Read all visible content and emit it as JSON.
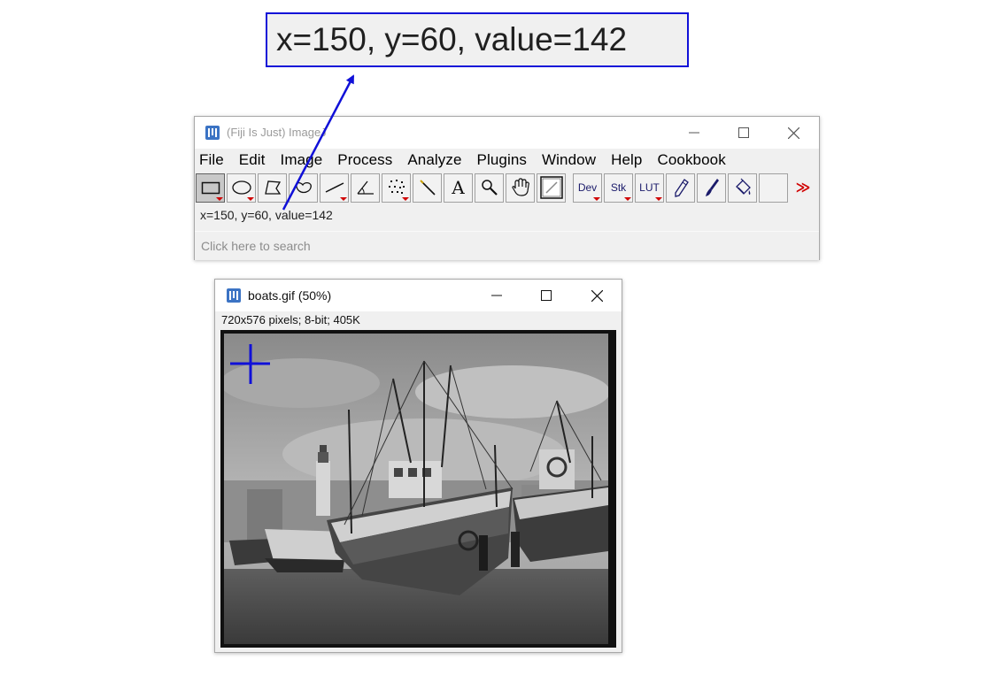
{
  "callout": {
    "text": "x=150, y=60, value=142"
  },
  "main_window": {
    "title": "(Fiji Is Just) ImageJ",
    "menus": [
      "File",
      "Edit",
      "Image",
      "Process",
      "Analyze",
      "Plugins",
      "Window",
      "Help",
      "Cookbook"
    ],
    "tools": [
      {
        "name": "rectangle-tool",
        "icon": "rectangle-icon",
        "active": true
      },
      {
        "name": "oval-tool",
        "icon": "oval-icon"
      },
      {
        "name": "polygon-tool",
        "icon": "polygon-icon"
      },
      {
        "name": "freehand-tool",
        "icon": "freehand-icon"
      },
      {
        "name": "line-tool",
        "icon": "line-icon"
      },
      {
        "name": "angle-tool",
        "icon": "angle-icon"
      },
      {
        "name": "point-tool",
        "icon": "point-icon"
      },
      {
        "name": "wand-tool",
        "icon": "wand-icon"
      },
      {
        "name": "text-tool",
        "icon": "text-icon",
        "label": "A"
      },
      {
        "name": "magnifier-tool",
        "icon": "magnifier-icon"
      },
      {
        "name": "scroll-tool",
        "icon": "hand-icon"
      },
      {
        "name": "color-picker-tool",
        "icon": "color-picker-icon"
      },
      {
        "name": "dev-menu-tool",
        "label": "Dev"
      },
      {
        "name": "stk-menu-tool",
        "label": "Stk"
      },
      {
        "name": "lut-menu-tool",
        "label": "LUT"
      },
      {
        "name": "pencil-tool",
        "icon": "pencil-icon"
      },
      {
        "name": "brush-tool",
        "icon": "brush-icon"
      },
      {
        "name": "flood-fill-tool",
        "icon": "bucket-icon"
      },
      {
        "name": "empty-tool-slot",
        "icon": "blank"
      },
      {
        "name": "more-tools-button",
        "label": "≫"
      }
    ],
    "status": "x=150, y=60, value=142",
    "search_placeholder": "Click here to search"
  },
  "image_window": {
    "title": "boats.gif (50%)",
    "info": "720x576 pixels; 8-bit; 405K"
  },
  "colors": {
    "annotation": "#1010d8",
    "dropdown_marker": "#d00000"
  }
}
